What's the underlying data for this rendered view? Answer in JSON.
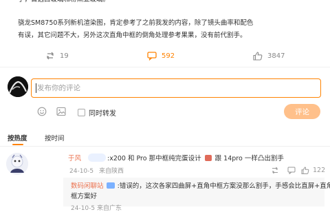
{
  "post": {
    "top_line": "了，首选白玻璃和粉黛亚玻璃。",
    "body_lines": [
      "骁龙SM8750系列新机渲染图，肯定参考了之前我发的内容，除了镜头曲率和配色",
      "有误，其它问题不大，另外这次直角中框的倒角处理参考果果，没有前代割手。"
    ]
  },
  "actions": {
    "retweet_count": "19",
    "comment_count": "592",
    "like_count": "3847"
  },
  "composer": {
    "placeholder": "发布你的评论",
    "repost_label": "同时转发",
    "submit_label": "评论"
  },
  "sort_tabs": {
    "hot": "按热度",
    "time": "按时间"
  },
  "comment": {
    "user": "于风",
    "text": ":x200 和 Pro 那中框纯完蛋设计",
    "text_tail": "跟 14pro 一样凸出割手",
    "date": "24-10-5",
    "location": "来自陕西",
    "like_count": "122"
  },
  "reply": {
    "user": "数码闲聊站",
    "text_1": ":错误的，这次各家四曲屏+直角中框方案没那么割手，手感会比直屏+直角中",
    "text_2": "框方案好",
    "meta": "24-10-5 来自广东"
  },
  "colors": {
    "accent": "#ff8200",
    "username": "#eb7350",
    "submit_disabled": "#ffc08a"
  }
}
